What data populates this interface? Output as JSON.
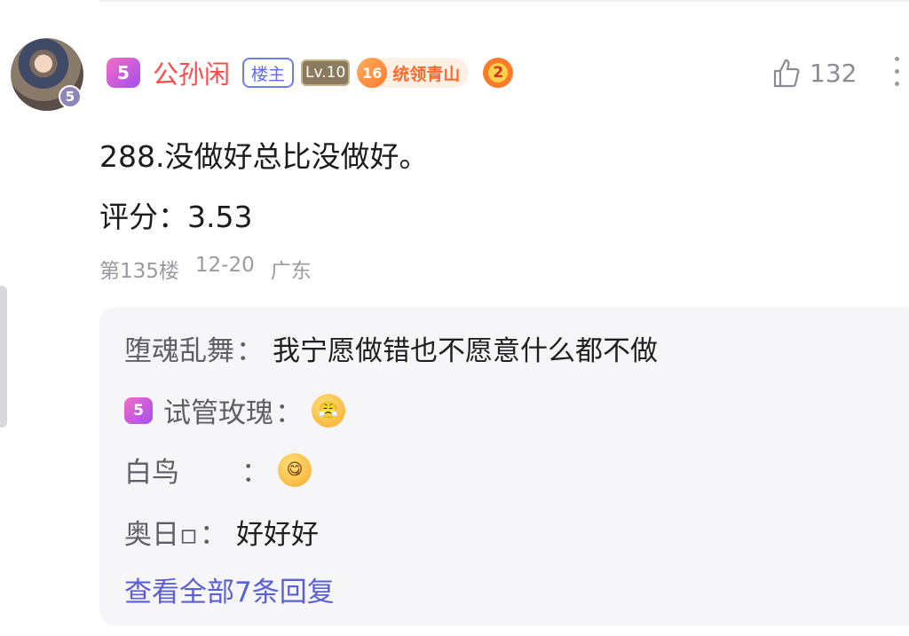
{
  "comment": {
    "avatar_level": "5",
    "crown_label": "5",
    "username": "公孙闲",
    "owner_badge": "楼主",
    "level_badge": "Lv.10",
    "title_badge_num": "16",
    "title_badge_text": "统领青山",
    "rank_badge": "2",
    "like_count": "132",
    "content": "288.没做好总比没做好。",
    "score": "评分：3.53",
    "floor": "第135楼",
    "date": "12-20",
    "location": "广东"
  },
  "replies": [
    {
      "name": "堕魂乱舞",
      "sep": "：",
      "text": "我宁愿做错也不愿意什么都不做",
      "has_crown": false
    },
    {
      "name": "试管玫瑰",
      "sep": "：",
      "text": "",
      "has_crown": true,
      "emoji": "angry-face-emoji"
    },
    {
      "name": "白鸟",
      "sep": "：",
      "text": "",
      "has_crown": false,
      "emoji": "yum-face-emoji"
    },
    {
      "name": "奥日▫",
      "sep": "：",
      "text": "好好好",
      "has_crown": false
    }
  ],
  "reply_crown_label": "5",
  "view_all": "查看全部7条回复",
  "icons": {
    "like": "thumbs-up-icon",
    "more": "more-vertical-icon"
  },
  "colors": {
    "username": "#ff4a4a",
    "link": "#5b5fd4",
    "owner_badge": "#5d6be8"
  }
}
